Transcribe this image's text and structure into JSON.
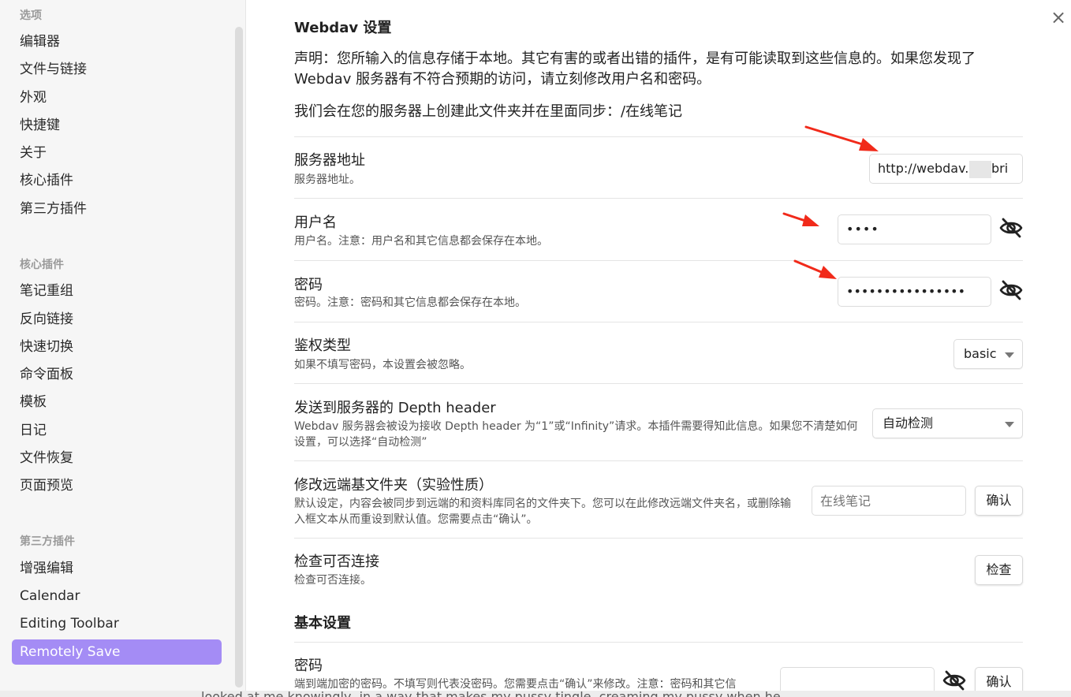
{
  "sidebar": {
    "groups": [
      {
        "title": "选项",
        "items": [
          "编辑器",
          "文件与链接",
          "外观",
          "快捷键",
          "关于",
          "核心插件",
          "第三方插件"
        ]
      },
      {
        "title": "核心插件",
        "items": [
          "笔记重组",
          "反向链接",
          "快速切换",
          "命令面板",
          "模板",
          "日记",
          "文件恢复",
          "页面预览"
        ]
      },
      {
        "title": "第三方插件",
        "items": [
          "增强编辑",
          "Calendar",
          "Editing Toolbar",
          "Remotely Save"
        ]
      }
    ],
    "active_item": "Remotely Save",
    "accent_color": "#a48cf5"
  },
  "close_label": "×",
  "webdav": {
    "title": "Webdav 设置",
    "disclaimer": "声明：您所输入的信息存储于本地。其它有害的或者出错的插件，是有可能读取到这些信息的。如果您发现了 Webdav 服务器有不符合预期的访问，请立刻修改用户名和密码。",
    "folder_note": "我们会在您的服务器上创建此文件夹并在里面同步：/在线笔记",
    "server": {
      "name": "服务器地址",
      "desc": "服务器地址。",
      "value_start": "http://webdav.c",
      "value_end": "bri"
    },
    "username": {
      "name": "用户名",
      "desc": "用户名。注意：用户名和其它信息都会保存在本地。",
      "value": "••••"
    },
    "password": {
      "name": "密码",
      "desc": "密码。注意：密码和其它信息都会保存在本地。",
      "value": "••••••••••••••••"
    },
    "auth": {
      "name": "鉴权类型",
      "desc": "如果不填写密码，本设置会被忽略。",
      "value": "basic"
    },
    "depth": {
      "name": "发送到服务器的 Depth header",
      "desc": "Webdav 服务器会被设为接收 Depth header 为“1”或“Infinity”请求。本插件需要得知此信息。如果您不清楚如何设置，可以选择“自动检测”",
      "value": "自动检测"
    },
    "remote_folder": {
      "name": "修改远端基文件夹（实验性质）",
      "desc": "默认设定，内容会被同步到远端的和资料库同名的文件夹下。您可以在此修改远端文件夹名，或删除输入框文本从而重设到默认值。您需要点击“确认”。",
      "placeholder": "在线笔记",
      "button": "确认"
    },
    "check": {
      "name": "检查可否连接",
      "desc": "检查可否连接。",
      "button": "检查"
    }
  },
  "basic": {
    "title": "基本设置",
    "password": {
      "name": "密码",
      "desc": "端到端加密的密码。不填写则代表没密码。您需要点击“确认”来修改。注意：密码和其它信",
      "button": "确认"
    }
  },
  "background_text": "looked at me knowingly, in a way that makes my pussy tingle, creaming my pussy when he"
}
